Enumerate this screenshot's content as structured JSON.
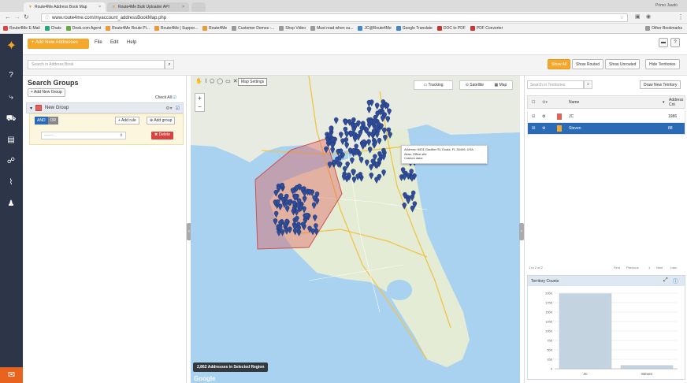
{
  "browser": {
    "tabs": [
      {
        "label": "Route4Me Address Book Map"
      },
      {
        "label": "Route4Me Bulk Uploader API"
      }
    ],
    "profile": "Primo Jaudo",
    "url": "www.route4me.com/myaccount_addressBookMap.php",
    "bookmarks": [
      {
        "label": "Route4Me E-Mail",
        "color": "#d44"
      },
      {
        "label": "Chats",
        "color": "#2a7"
      },
      {
        "label": "Desk.com Agent",
        "color": "#6a4"
      },
      {
        "label": "Route4Me Route Pl...",
        "color": "#e93"
      },
      {
        "label": "Route4Me | Suppor...",
        "color": "#e93"
      },
      {
        "label": "Route4Me",
        "color": "#e93"
      },
      {
        "label": "Customer Demos -...",
        "color": "#999"
      },
      {
        "label": "Shop Video",
        "color": "#999"
      },
      {
        "label": "Must read when su...",
        "color": "#999"
      },
      {
        "label": "JC@Route4Me",
        "color": "#48c"
      },
      {
        "label": "Google Translate",
        "color": "#48c"
      },
      {
        "label": "DOC to PDF",
        "color": "#c33"
      },
      {
        "label": "PDF Converter",
        "color": "#c33"
      },
      {
        "label": "Other Bookmarks",
        "color": "#999"
      }
    ]
  },
  "toolbar": {
    "add_label": "+ Add New Addresses",
    "menus": [
      "File",
      "Edit",
      "Help"
    ]
  },
  "filter": {
    "search_placeholder": "Search in Address Book",
    "buttons": [
      {
        "label": "Show All",
        "active": true
      },
      {
        "label": "Show Routed",
        "active": false
      },
      {
        "label": "Show Unrouted",
        "active": false
      },
      {
        "label": "Hide Territories",
        "active": false
      }
    ]
  },
  "groups": {
    "title": "Search Groups",
    "add_group": "+ Add New Group",
    "check_all": "Check All",
    "group_name": "New Group",
    "and_label": "AND",
    "or_label": "OR",
    "add_rule": "+ Add rule",
    "add_subgroup": "Add group",
    "rule_select": "-------",
    "delete": "Delete"
  },
  "map": {
    "settings": "Map Settings",
    "tracking": "Tracking",
    "satellite": "Satellite",
    "map": "Map",
    "info": {
      "address": "Address: 6531 Gaultier St, Ocala, FL 34449, USA",
      "alias": "Alias: Office site",
      "custom": "Custom data:"
    },
    "selected": "2,862 Addresses in Selected Region",
    "provider": "Google"
  },
  "territories": {
    "search_placeholder": "Search in Territories",
    "draw_new": "Draw New Territory",
    "headers": {
      "name": "Name",
      "count": "Address Cnt"
    },
    "rows": [
      {
        "name": "JC",
        "count": "1986",
        "color": "#e0605a",
        "selected": false
      },
      {
        "name": "Steven",
        "count": "88",
        "color": "#f4a82c",
        "selected": true
      }
    ],
    "pagination": {
      "summary": "1 to 2 of 2",
      "first": "First",
      "prev": "Previous",
      "page": "1",
      "next": "Next",
      "last": "Last"
    },
    "counts_title": "Territory Counts"
  },
  "chart_data": {
    "type": "bar",
    "title": "Territory Counts",
    "categories": [
      "JC",
      "Steven"
    ],
    "values": [
      1986,
      88
    ],
    "ylim": [
      0,
      2000
    ],
    "yticks": [
      0,
      250,
      500,
      750,
      1000,
      1250,
      1500,
      1750,
      2000
    ],
    "color": "#c4d3e0",
    "grid": true
  }
}
